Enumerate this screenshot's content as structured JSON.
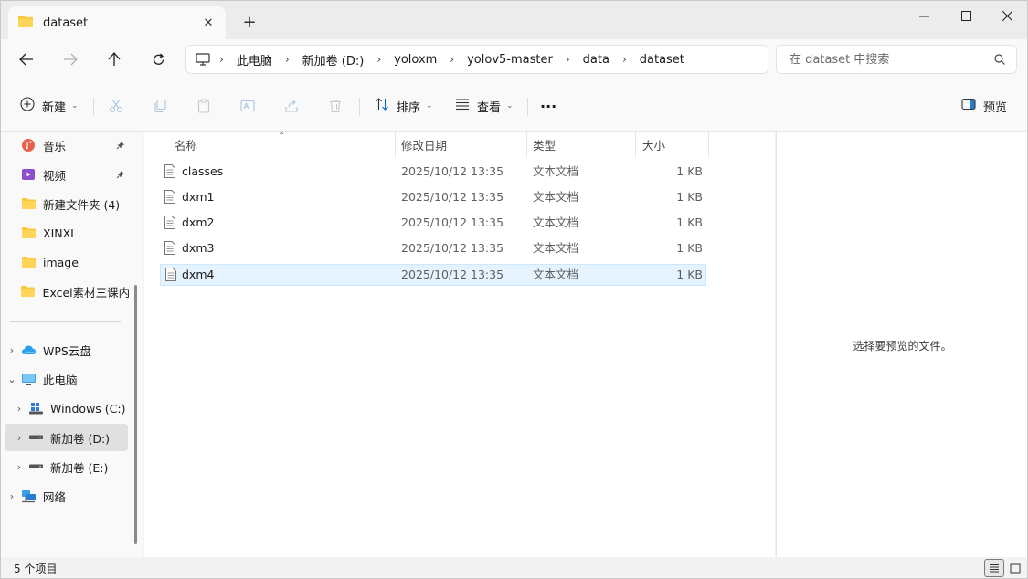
{
  "tab": {
    "title": "dataset",
    "close": "✕",
    "new": "+"
  },
  "address": {
    "crumbs": [
      "此电脑",
      "新加卷 (D:)",
      "yoloxm",
      "yolov5-master",
      "data",
      "dataset"
    ]
  },
  "search": {
    "placeholder": "在 dataset 中搜索"
  },
  "toolbar": {
    "new_label": "新建",
    "sort_label": "排序",
    "view_label": "查看",
    "more_label": "···",
    "preview_label": "预览"
  },
  "sidebar": {
    "items": [
      {
        "label": "音乐"
      },
      {
        "label": "视频"
      },
      {
        "label": "新建文件夹 (4)"
      },
      {
        "label": "XINXI"
      },
      {
        "label": "image"
      },
      {
        "label": "Excel素材三课内"
      },
      {
        "label": "WPS云盘"
      },
      {
        "label": "此电脑"
      },
      {
        "label": "Windows (C:)"
      },
      {
        "label": "新加卷 (D:)"
      },
      {
        "label": "新加卷 (E:)"
      },
      {
        "label": "网络"
      }
    ]
  },
  "columns": {
    "name": "名称",
    "modified": "修改日期",
    "type": "类型",
    "size": "大小"
  },
  "files": [
    {
      "name": "classes",
      "modified": "2025/10/12 13:35",
      "type": "文本文档",
      "size": "1 KB"
    },
    {
      "name": "dxm1",
      "modified": "2025/10/12 13:35",
      "type": "文本文档",
      "size": "1 KB"
    },
    {
      "name": "dxm2",
      "modified": "2025/10/12 13:35",
      "type": "文本文档",
      "size": "1 KB"
    },
    {
      "name": "dxm3",
      "modified": "2025/10/12 13:35",
      "type": "文本文档",
      "size": "1 KB"
    },
    {
      "name": "dxm4",
      "modified": "2025/10/12 13:35",
      "type": "文本文档",
      "size": "1 KB"
    }
  ],
  "preview": {
    "message": "选择要预览的文件。"
  },
  "status": {
    "count": "5 个项目"
  },
  "colors": {
    "accent": "#0067c0",
    "folder": "#f8c73c",
    "selection": "#e5f3ff"
  }
}
